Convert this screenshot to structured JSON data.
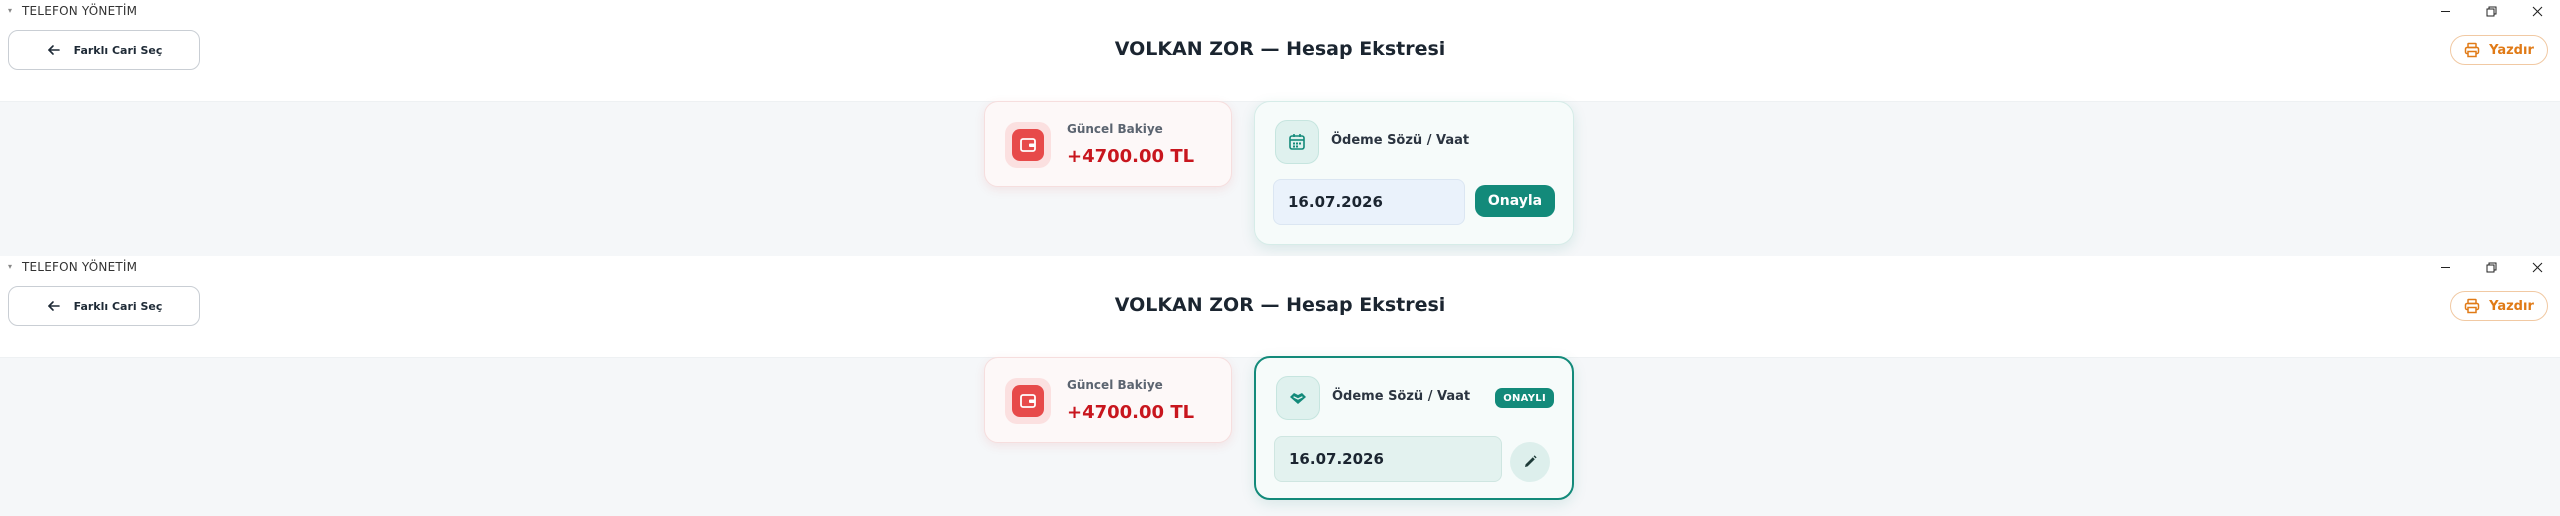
{
  "colors": {
    "accent": "#138a7a",
    "danger": "#c8161e",
    "print": "#e07a16",
    "balance_icon": "#e74a4a"
  },
  "windows": [
    {
      "titlebar": {
        "title": "TELEFON YÖNETİM"
      },
      "header": {
        "back_label": "Farklı Cari Seç",
        "title": "VOLKAN ZOR — Hesap Ekstresi",
        "print_label": "Yazdır"
      },
      "balance": {
        "label": "Güncel Bakiye",
        "value": "+4700.00 TL",
        "icon": "wallet-icon"
      },
      "promise": {
        "label": "Ödeme Sözü / Vaat",
        "icon": "calendar-icon",
        "date": "16.07.2026",
        "confirm_label": "Onayla",
        "state": "unconfirmed"
      }
    },
    {
      "titlebar": {
        "title": "TELEFON YÖNETİM"
      },
      "header": {
        "back_label": "Farklı Cari Seç",
        "title": "VOLKAN ZOR — Hesap Ekstresi",
        "print_label": "Yazdır"
      },
      "balance": {
        "label": "Güncel Bakiye",
        "value": "+4700.00 TL",
        "icon": "wallet-icon"
      },
      "promise": {
        "label": "Ödeme Sözü / Vaat",
        "icon": "handshake-icon",
        "badge": "ONAYLI",
        "date": "16.07.2026",
        "state": "confirmed"
      }
    }
  ]
}
